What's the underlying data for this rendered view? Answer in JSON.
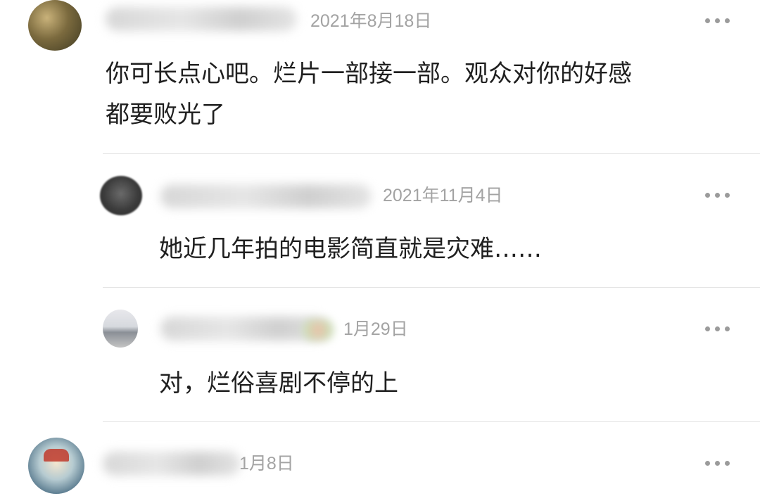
{
  "comments": [
    {
      "date": "2021年8月18日",
      "text_lines": [
        "你可长点心吧。烂片一部接一部。观众对你的好感",
        "都要败光了"
      ]
    },
    {
      "date": "2021年11月4日",
      "text": "她近几年拍的电影简直就是灾难……"
    },
    {
      "date": "1月29日",
      "text": "对，烂俗喜剧不停的上"
    },
    {
      "date": "1月8日"
    }
  ],
  "icons": {
    "more": "more-dots-icon"
  }
}
